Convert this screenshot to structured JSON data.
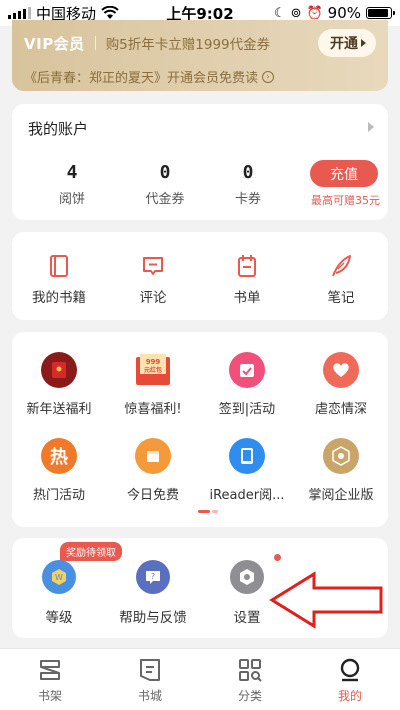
{
  "status_bar": {
    "carrier": "中国移动",
    "time": "上午9:02",
    "battery": "90%",
    "battery_level": 0.9
  },
  "vip": {
    "label": "VIP会员",
    "offer": "购5折年卡立赠1999代金券",
    "button": "开通",
    "subtitle": "《后青春：郑正的夏天》开通会员免费读"
  },
  "account": {
    "title": "我的账户",
    "items": [
      {
        "value": "4",
        "label": "阅饼"
      },
      {
        "value": "0",
        "label": "代金券"
      },
      {
        "value": "0",
        "label": "卡券"
      }
    ],
    "recharge_button": "充值",
    "recharge_note": "最高可赠35元"
  },
  "shelf": {
    "items": [
      {
        "label": "我的书籍",
        "icon": "book-icon"
      },
      {
        "label": "评论",
        "icon": "comment-icon"
      },
      {
        "label": "书单",
        "icon": "booklist-icon"
      },
      {
        "label": "笔记",
        "icon": "feather-icon"
      }
    ]
  },
  "grid": {
    "row1": [
      {
        "label": "新年送福利",
        "icon": "red-envelope-icon",
        "color": "#8b1a1a"
      },
      {
        "label": "惊喜福利!",
        "icon": "coupon-icon",
        "color": "#e84a3a",
        "badge_text": "999元红包"
      },
      {
        "label": "签到|活动",
        "icon": "calendar-check-icon",
        "color": "#f0507a"
      },
      {
        "label": "虐恋情深",
        "icon": "heart-icon",
        "color": "#f06a5a"
      }
    ],
    "row2": [
      {
        "label": "热门活动",
        "icon": "hot-icon",
        "color": "#f07a2a",
        "glyph": "热"
      },
      {
        "label": "今日免费",
        "icon": "gift-icon",
        "color": "#f59a3a"
      },
      {
        "label": "iReader阅...",
        "icon": "tablet-icon",
        "color": "#2f8df0"
      },
      {
        "label": "掌阅企业版",
        "icon": "enterprise-icon",
        "color": "#c9a56a"
      }
    ]
  },
  "tools": {
    "reward_badge": "奖励待领取",
    "items": [
      {
        "label": "等级",
        "icon": "level-icon",
        "color": "#4a90e2"
      },
      {
        "label": "帮助与反馈",
        "icon": "help-icon",
        "color": "#5a6fbf"
      },
      {
        "label": "设置",
        "icon": "settings-icon",
        "color": "#8e8e93"
      }
    ]
  },
  "tabbar": {
    "tabs": [
      {
        "label": "书架",
        "icon": "bookshelf-icon"
      },
      {
        "label": "书城",
        "icon": "bookstore-icon"
      },
      {
        "label": "分类",
        "icon": "category-icon"
      },
      {
        "label": "我的",
        "icon": "profile-icon"
      }
    ],
    "active_index": 3
  },
  "colors": {
    "accent": "#e85a4f",
    "vip_gold": "#d8c39c",
    "background": "#f2f2f2"
  }
}
